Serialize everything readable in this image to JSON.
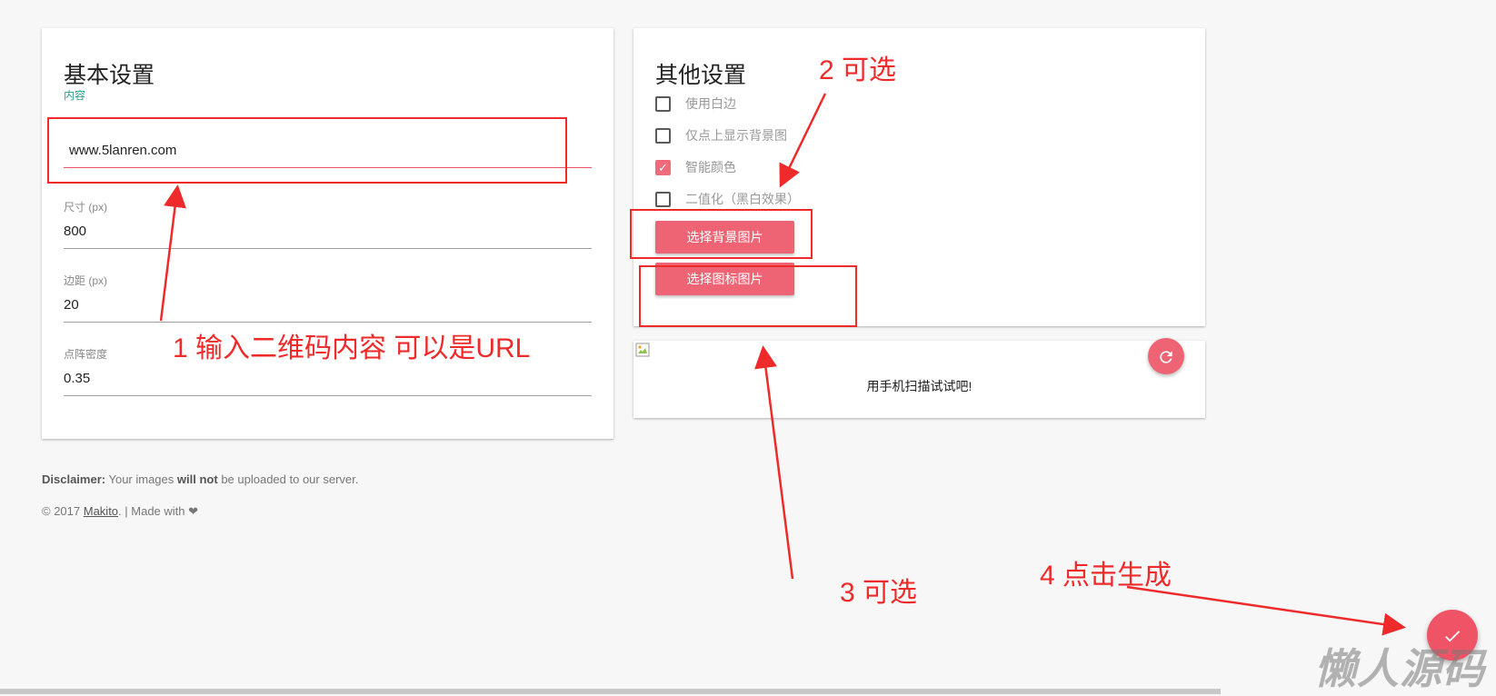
{
  "basic": {
    "title": "基本设置",
    "content_label": "内容",
    "content_value": "www.5lanren.com",
    "size_label": "尺寸 (px)",
    "size_value": "800",
    "margin_label": "边距 (px)",
    "margin_value": "20",
    "dot_label": "点阵密度",
    "dot_value": "0.35"
  },
  "other": {
    "title": "其他设置",
    "options": [
      {
        "label": "使用白边",
        "checked": false
      },
      {
        "label": "仅点上显示背景图",
        "checked": false
      },
      {
        "label": "智能颜色",
        "checked": true
      },
      {
        "label": "二值化（黑白效果）",
        "checked": false
      }
    ],
    "bg_button": "选择背景图片",
    "icon_button": "选择图标图片"
  },
  "preview": {
    "caption": "用手机扫描试试吧!",
    "refresh_icon": "refresh-icon"
  },
  "disclaimer": {
    "label": "Disclaimer:",
    "pre": "Your images",
    "bold": "will not",
    "post": "be uploaded to our server."
  },
  "footer": {
    "copyright": "© 2017",
    "author": "Makito",
    "made_with": ". | Made with",
    "heart": "❤"
  },
  "fab": {
    "icon": "check-icon"
  },
  "annotations": {
    "a1": "1 输入二维码内容 可以是URL",
    "a2": "2 可选",
    "a3": "3 可选",
    "a4": "4 点击生成"
  },
  "watermark": "懒人源码",
  "colors": {
    "accent": "#ef5466",
    "annotation": "#ee2a2a",
    "teal": "#2a9d8f"
  }
}
